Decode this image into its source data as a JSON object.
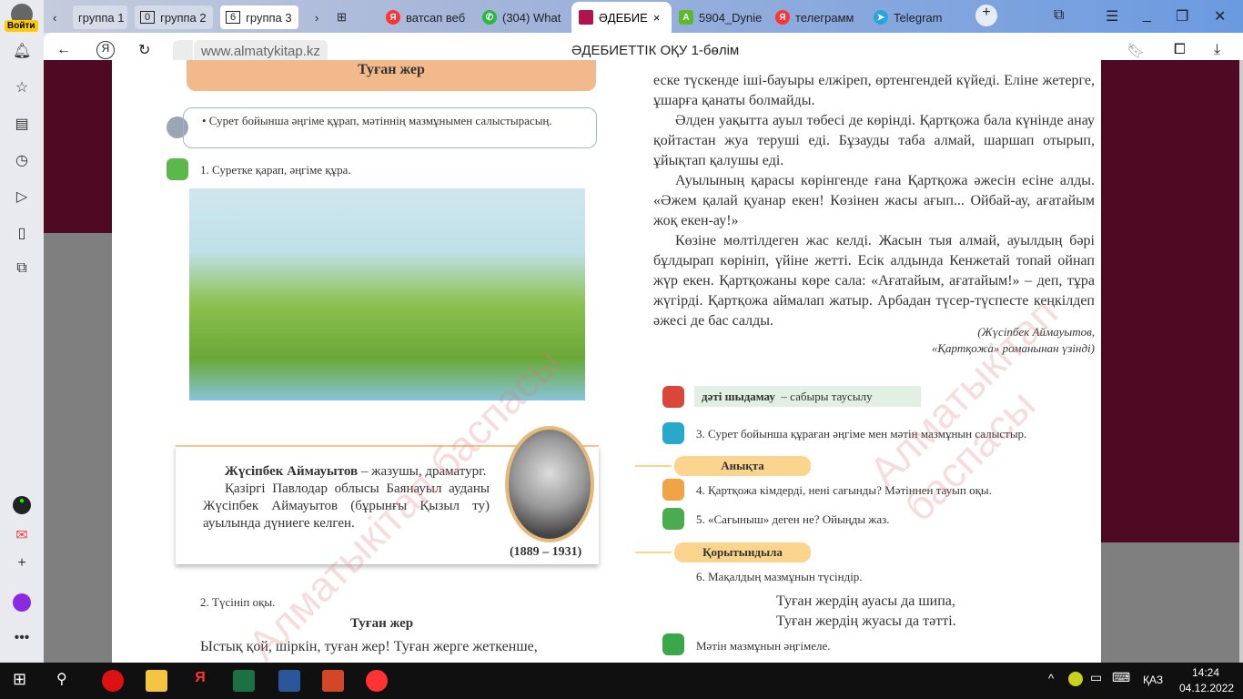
{
  "browser": {
    "login_label": "Войти",
    "groups": [
      {
        "count": "",
        "label": "группа 1"
      },
      {
        "count": "0",
        "label": "группа 2"
      },
      {
        "count": "6",
        "label": "группа 3"
      }
    ],
    "tabs": [
      {
        "label": "ватсап веб",
        "icon": "yandex-icon",
        "color": "#f33"
      },
      {
        "label": "(304) What",
        "icon": "whatsapp-icon",
        "color": "#2bb741"
      },
      {
        "label": "ӘДЕБИЕ",
        "icon": "book-icon",
        "color": "#b0144e",
        "active": true
      },
      {
        "label": "5904_Dynie",
        "icon": "a-icon",
        "color": "#5cb82d"
      },
      {
        "label": "телеграмм",
        "icon": "yandex-icon",
        "color": "#f33"
      },
      {
        "label": "Telegram",
        "icon": "telegram-icon",
        "color": "#2aa3de"
      }
    ],
    "url": "www.almatykitap.kz",
    "page_title": "ӘДЕБИЕТТІК ОҚУ 1-бөлім"
  },
  "left": {
    "banner": "Туған жер",
    "goal": "• Сурет бойынша әңгіме құрап, мәтіннің мазмұнымен салыстырасың.",
    "task1": "1. Суретке қарап, әңгіме құра.",
    "bio_name": "Жүсіпбек Аймауытов",
    "bio_rest": " – жазушы, драматург.",
    "bio_p2": "Қазіргі Павлодар облысы Баянауыл ауданы Жүсіпбек Аймауытов (бұрынғы Қызыл ту) ауылында дүниеге келген.",
    "years": "(1889 – 1931)",
    "task2": "2. Түсініп оқы.",
    "story_title": "Туған жер",
    "story_line": "Ыстық қой, шіркін, туған жер! Туған жерге жеткенше,"
  },
  "right": {
    "paragraphs": [
      "еске түскенде іші-бауыры елжіреп, өртенгендей күйеді. Еліне жетерге, ұшарға қанаты болмайды.",
      "Әлден уақытта ауыл төбесі де көрінді. Қартқожа бала күнінде анау қойтастан жуа теруші еді. Бұзауды таба алмай, шаршап отырып, ұйықтап қалушы еді.",
      "Ауылының қарасы көрінгенде ғана Қартқожа әжесін есіне алды. «Әжем қалай қуанар екен! Көзінен жасы ағып... Ойбай-ау, ағатайым жоқ екен-ау!»",
      "Көзіне мөлтілдеген жас келді. Жасын тыя алмай, ауылдың бәрі бұлдырап көрініп, үйіне жетті. Есік алдында Кенжетай топай ойнап жүр екен. Қартқожаны көре сала: «Ағатайым, ағатайым!» – деп, тұра жүгірді. Қартқожа аймалап жатыр. Арбадан түсер-түспесте кеңкілдеп әжесі де бас салды."
    ],
    "cite1": "(Жүсіпбек Аймауытов,",
    "cite2": "«Қартқожа» романынан үзінді)",
    "vocab_word": "дәті шыдамау",
    "vocab_def": "– сабыры таусылу",
    "task3": "3. Сурет бойынша құраған әңгіме мен мәтін мазмұнын салыстыр.",
    "pill1": "Анықта",
    "task4": "4. Қартқожа кімдерді, нені сағынды? Мәтіннен тауып оқы.",
    "task5": "5. «Сағыныш» деген не? Ойыңды жаз.",
    "pill2": "Қорытындыла",
    "task6": "6. Мақалдың мазмұнын түсіндір.",
    "proverb1": "Туған жердің ауасы да шипа,",
    "proverb2": "Туған жердің жуасы да тәтті.",
    "task7": "Мәтін мазмұнын әңгімеле."
  },
  "watermark": "Алматыкітап баспасы",
  "taskbar": {
    "lang": "ҚАЗ",
    "time": "14:24",
    "date": "04.12.2022"
  }
}
